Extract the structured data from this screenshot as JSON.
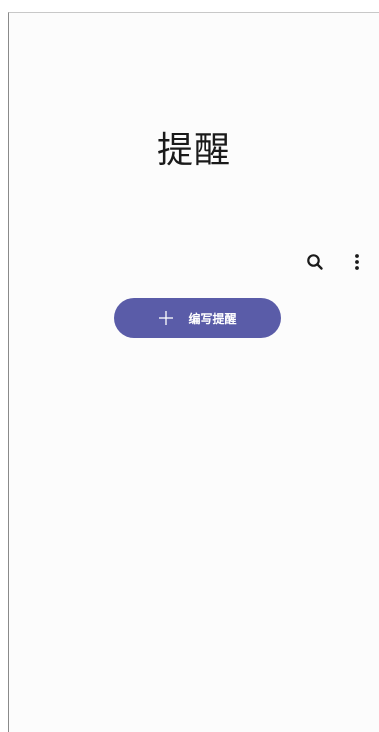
{
  "header": {
    "title": "提醒"
  },
  "toolbar": {
    "search_icon": "search-icon",
    "more_icon": "more-vertical-icon"
  },
  "compose": {
    "label": "编写提醒",
    "icon": "plus-icon"
  },
  "colors": {
    "accent": "#5a5ca8",
    "background": "#fcfcfc",
    "title_text": "#1a1a1a"
  }
}
